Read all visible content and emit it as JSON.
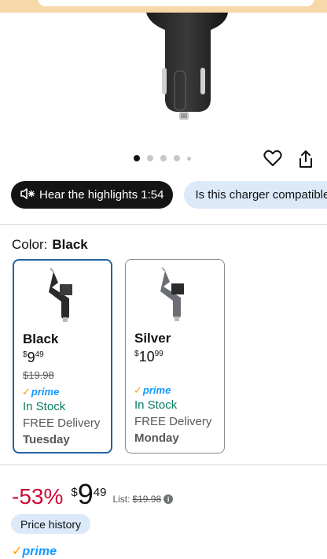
{
  "carousel": {
    "dot_count": 5,
    "active_index": 0
  },
  "highlights_chip": {
    "label": "Hear the highlights 1:54"
  },
  "question_chip": {
    "label": "Is this charger compatible"
  },
  "color": {
    "label": "Color:",
    "selected": "Black"
  },
  "variants": [
    {
      "name": "Black",
      "price_symbol": "$",
      "price_whole": "9",
      "price_cents": "49",
      "list_price": "$19.98",
      "prime": "prime",
      "stock": "In Stock",
      "delivery_line": "FREE Delivery",
      "delivery_day": "Tuesday",
      "selected": true
    },
    {
      "name": "Silver",
      "price_symbol": "$",
      "price_whole": "10",
      "price_cents": "99",
      "prime": "prime",
      "stock": "In Stock",
      "delivery_line": "FREE Delivery",
      "delivery_day": "Monday",
      "selected": false
    }
  ],
  "deal": {
    "discount": "-53%",
    "price_symbol": "$",
    "price_whole": "9",
    "price_cents": "49",
    "list_label": "List:",
    "list_price": "$19.98"
  },
  "price_history": {
    "label": "Price history"
  },
  "prime_badge": "prime",
  "colors": {
    "prime_blue": "#1399ff",
    "prime_check": "#ff9900",
    "discount_red": "#cc0c39",
    "selected_border": "#2162a1",
    "stock_green": "#067d62"
  }
}
